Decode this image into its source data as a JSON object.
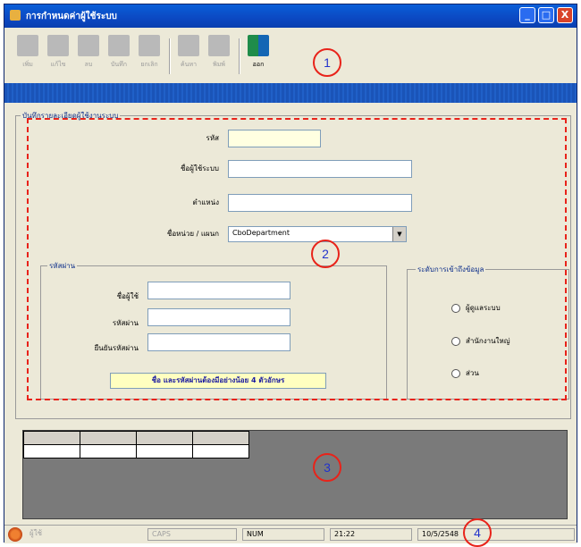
{
  "window": {
    "title": "การกำหนดค่าผู้ใช้ระบบ",
    "controls": [
      "_",
      "□",
      "X"
    ]
  },
  "toolbar": {
    "buttons": [
      {
        "label": "เพิ่ม",
        "icon": "add-user-icon",
        "enabled": false
      },
      {
        "label": "แก้ไข",
        "icon": "edit-icon",
        "enabled": false
      },
      {
        "label": "ลบ",
        "icon": "delete-icon",
        "enabled": false
      },
      {
        "label": "บันทึก",
        "icon": "save-icon",
        "enabled": false
      },
      {
        "label": "ยกเลิก",
        "icon": "cancel-icon",
        "enabled": false
      },
      {
        "label": "ค้นหา",
        "icon": "search-icon",
        "enabled": false
      },
      {
        "label": "พิมพ์",
        "icon": "print-icon",
        "enabled": false
      },
      {
        "label": "ออก",
        "icon": "exit-icon",
        "enabled": true
      }
    ]
  },
  "callouts": [
    "1",
    "2",
    "3",
    "4"
  ],
  "form": {
    "group_title": "บันทึกรายละเอียดผู้ใช้งานระบบ",
    "code_label": "รหัส",
    "code_value": "",
    "username_label": "ชื่อผู้ใช้ระบบ",
    "username_value": "",
    "position_label": "ตำแหน่ง",
    "position_value": "",
    "department_label": "ชื่อหน่วย / แผนก",
    "department_value": "CboDepartment"
  },
  "password_group": {
    "title": "รหัสผ่าน",
    "user_label": "ชื่อผู้ใช้",
    "password_label": "รหัสผ่าน",
    "confirm_label": "ยืนยันรหัสผ่าน",
    "note": "ชื่อ และรหัสผ่านต้องมีอย่างน้อย 4 ตัวอักษร"
  },
  "access_group": {
    "title": "ระดับการเข้าถึงข้อมูล",
    "options": [
      "ผู้ดูแลระบบ",
      "สำนักงานใหญ่",
      "ส่วน"
    ]
  },
  "statusbar": {
    "user": "ผู้ใช้",
    "caps": "CAPS",
    "num": "NUM",
    "time": "21:22",
    "date": "10/5/2548"
  },
  "colors": {
    "accent": "#0a5fd8",
    "callout_ring": "#e8231a",
    "callout_text": "#2233cc"
  }
}
